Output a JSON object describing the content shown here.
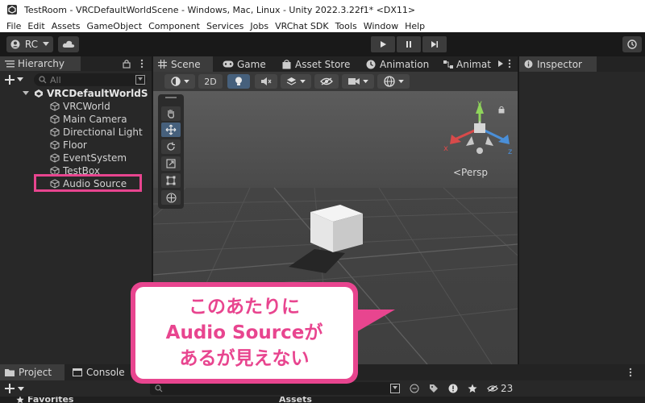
{
  "window": {
    "title": "TestRoom - VRCDefaultWorldScene - Windows, Mac, Linux - Unity 2022.3.22f1* <DX11>"
  },
  "menu": {
    "items": [
      "File",
      "Edit",
      "Assets",
      "GameObject",
      "Component",
      "Services",
      "Jobs",
      "VRChat SDK",
      "Tools",
      "Window",
      "Help"
    ]
  },
  "toolbar": {
    "account_label": "RC"
  },
  "hierarchy": {
    "tab_label": "Hierarchy",
    "search_placeholder": "All",
    "scene_name": "VRCDefaultWorldS",
    "items": [
      "VRCWorld",
      "Main Camera",
      "Directional Light",
      "Floor",
      "EventSystem",
      "TestBox",
      "Audio Source"
    ]
  },
  "scene": {
    "tabs": [
      "Scene",
      "Game",
      "Asset Store",
      "Animation",
      "Animat"
    ],
    "mode_2d": "2D",
    "persp_label": "<Persp",
    "gizmo_axes": {
      "y": "y",
      "x": "x",
      "z": "z"
    }
  },
  "inspector": {
    "tab_label": "Inspector"
  },
  "bottom": {
    "tabs": [
      "Project",
      "Console"
    ],
    "favorites_label": "Favorites",
    "assets_label": "Assets",
    "hidden_count": "23"
  },
  "callout": {
    "lines": [
      "このあたりに",
      "Audio Sourceが",
      "あるが見えない"
    ],
    "color": "#e8458f"
  }
}
